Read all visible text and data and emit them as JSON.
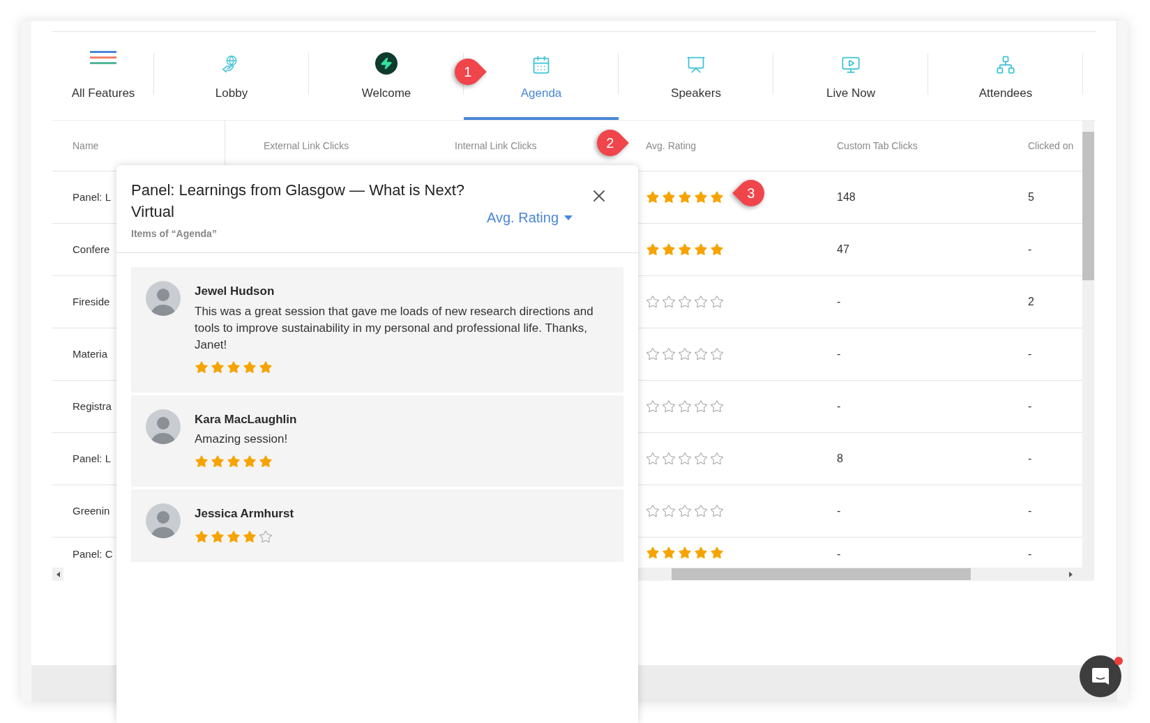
{
  "tabs": [
    {
      "label": "All Features",
      "selected": false
    },
    {
      "label": "Lobby",
      "selected": false
    },
    {
      "label": "Welcome",
      "selected": false
    },
    {
      "label": "Agenda",
      "selected": true
    },
    {
      "label": "Speakers",
      "selected": false
    },
    {
      "label": "Live Now",
      "selected": false
    },
    {
      "label": "Attendees",
      "selected": false
    }
  ],
  "table": {
    "columns": [
      "Name",
      "External Link Clicks",
      "Internal Link Clicks",
      "Avg. Rating",
      "Custom Tab Clicks",
      "Clicked on"
    ],
    "rows": [
      {
        "name": "Panel: L",
        "stars": 5,
        "custom_tab_clicks": "148",
        "clicked_on": "5"
      },
      {
        "name": "Confere",
        "stars": 5,
        "custom_tab_clicks": "47",
        "clicked_on": "-"
      },
      {
        "name": "Fireside",
        "stars": 0,
        "custom_tab_clicks": "-",
        "clicked_on": "2"
      },
      {
        "name": "Materia",
        "stars": 0,
        "custom_tab_clicks": "-",
        "clicked_on": "-"
      },
      {
        "name": "Registra",
        "stars": 0,
        "custom_tab_clicks": "-",
        "clicked_on": "-"
      },
      {
        "name": "Panel: L",
        "stars": 0,
        "custom_tab_clicks": "8",
        "clicked_on": "-"
      },
      {
        "name": "Greenin",
        "stars": 0,
        "custom_tab_clicks": "-",
        "clicked_on": "-"
      },
      {
        "name": "Panel: C",
        "stars": 5,
        "custom_tab_clicks": "-",
        "clicked_on": "-"
      }
    ]
  },
  "popup": {
    "title": "Panel: Learnings from Glasgow — What is Next? Virtual",
    "subtitle": "Items of “Agenda”",
    "sort_label": "Avg. Rating",
    "reviews": [
      {
        "name": "Jewel Hudson",
        "text": "This was a great session that gave me loads of new research directions and tools to improve sustainability in my personal and professional life. Thanks, Janet!",
        "stars": 5
      },
      {
        "name": "Kara MacLaughlin",
        "text": "Amazing session!",
        "stars": 5
      },
      {
        "name": "Jessica Armhurst",
        "stars": 4
      }
    ]
  },
  "callouts": [
    {
      "number": "1",
      "kind": "right"
    },
    {
      "number": "2",
      "kind": "right"
    },
    {
      "number": "3",
      "kind": "left"
    }
  ],
  "chat": {
    "unread": true
  }
}
